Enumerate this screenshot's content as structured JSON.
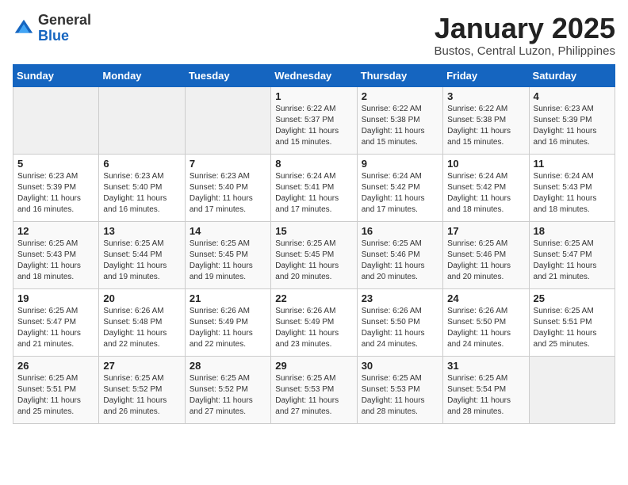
{
  "header": {
    "logo_general": "General",
    "logo_blue": "Blue",
    "month_title": "January 2025",
    "location": "Bustos, Central Luzon, Philippines"
  },
  "weekdays": [
    "Sunday",
    "Monday",
    "Tuesday",
    "Wednesday",
    "Thursday",
    "Friday",
    "Saturday"
  ],
  "weeks": [
    [
      {
        "day": "",
        "info": ""
      },
      {
        "day": "",
        "info": ""
      },
      {
        "day": "",
        "info": ""
      },
      {
        "day": "1",
        "info": "Sunrise: 6:22 AM\nSunset: 5:37 PM\nDaylight: 11 hours\nand 15 minutes."
      },
      {
        "day": "2",
        "info": "Sunrise: 6:22 AM\nSunset: 5:38 PM\nDaylight: 11 hours\nand 15 minutes."
      },
      {
        "day": "3",
        "info": "Sunrise: 6:22 AM\nSunset: 5:38 PM\nDaylight: 11 hours\nand 15 minutes."
      },
      {
        "day": "4",
        "info": "Sunrise: 6:23 AM\nSunset: 5:39 PM\nDaylight: 11 hours\nand 16 minutes."
      }
    ],
    [
      {
        "day": "5",
        "info": "Sunrise: 6:23 AM\nSunset: 5:39 PM\nDaylight: 11 hours\nand 16 minutes."
      },
      {
        "day": "6",
        "info": "Sunrise: 6:23 AM\nSunset: 5:40 PM\nDaylight: 11 hours\nand 16 minutes."
      },
      {
        "day": "7",
        "info": "Sunrise: 6:23 AM\nSunset: 5:40 PM\nDaylight: 11 hours\nand 17 minutes."
      },
      {
        "day": "8",
        "info": "Sunrise: 6:24 AM\nSunset: 5:41 PM\nDaylight: 11 hours\nand 17 minutes."
      },
      {
        "day": "9",
        "info": "Sunrise: 6:24 AM\nSunset: 5:42 PM\nDaylight: 11 hours\nand 17 minutes."
      },
      {
        "day": "10",
        "info": "Sunrise: 6:24 AM\nSunset: 5:42 PM\nDaylight: 11 hours\nand 18 minutes."
      },
      {
        "day": "11",
        "info": "Sunrise: 6:24 AM\nSunset: 5:43 PM\nDaylight: 11 hours\nand 18 minutes."
      }
    ],
    [
      {
        "day": "12",
        "info": "Sunrise: 6:25 AM\nSunset: 5:43 PM\nDaylight: 11 hours\nand 18 minutes."
      },
      {
        "day": "13",
        "info": "Sunrise: 6:25 AM\nSunset: 5:44 PM\nDaylight: 11 hours\nand 19 minutes."
      },
      {
        "day": "14",
        "info": "Sunrise: 6:25 AM\nSunset: 5:45 PM\nDaylight: 11 hours\nand 19 minutes."
      },
      {
        "day": "15",
        "info": "Sunrise: 6:25 AM\nSunset: 5:45 PM\nDaylight: 11 hours\nand 20 minutes."
      },
      {
        "day": "16",
        "info": "Sunrise: 6:25 AM\nSunset: 5:46 PM\nDaylight: 11 hours\nand 20 minutes."
      },
      {
        "day": "17",
        "info": "Sunrise: 6:25 AM\nSunset: 5:46 PM\nDaylight: 11 hours\nand 20 minutes."
      },
      {
        "day": "18",
        "info": "Sunrise: 6:25 AM\nSunset: 5:47 PM\nDaylight: 11 hours\nand 21 minutes."
      }
    ],
    [
      {
        "day": "19",
        "info": "Sunrise: 6:25 AM\nSunset: 5:47 PM\nDaylight: 11 hours\nand 21 minutes."
      },
      {
        "day": "20",
        "info": "Sunrise: 6:26 AM\nSunset: 5:48 PM\nDaylight: 11 hours\nand 22 minutes."
      },
      {
        "day": "21",
        "info": "Sunrise: 6:26 AM\nSunset: 5:49 PM\nDaylight: 11 hours\nand 22 minutes."
      },
      {
        "day": "22",
        "info": "Sunrise: 6:26 AM\nSunset: 5:49 PM\nDaylight: 11 hours\nand 23 minutes."
      },
      {
        "day": "23",
        "info": "Sunrise: 6:26 AM\nSunset: 5:50 PM\nDaylight: 11 hours\nand 24 minutes."
      },
      {
        "day": "24",
        "info": "Sunrise: 6:26 AM\nSunset: 5:50 PM\nDaylight: 11 hours\nand 24 minutes."
      },
      {
        "day": "25",
        "info": "Sunrise: 6:25 AM\nSunset: 5:51 PM\nDaylight: 11 hours\nand 25 minutes."
      }
    ],
    [
      {
        "day": "26",
        "info": "Sunrise: 6:25 AM\nSunset: 5:51 PM\nDaylight: 11 hours\nand 25 minutes."
      },
      {
        "day": "27",
        "info": "Sunrise: 6:25 AM\nSunset: 5:52 PM\nDaylight: 11 hours\nand 26 minutes."
      },
      {
        "day": "28",
        "info": "Sunrise: 6:25 AM\nSunset: 5:52 PM\nDaylight: 11 hours\nand 27 minutes."
      },
      {
        "day": "29",
        "info": "Sunrise: 6:25 AM\nSunset: 5:53 PM\nDaylight: 11 hours\nand 27 minutes."
      },
      {
        "day": "30",
        "info": "Sunrise: 6:25 AM\nSunset: 5:53 PM\nDaylight: 11 hours\nand 28 minutes."
      },
      {
        "day": "31",
        "info": "Sunrise: 6:25 AM\nSunset: 5:54 PM\nDaylight: 11 hours\nand 28 minutes."
      },
      {
        "day": "",
        "info": ""
      }
    ]
  ]
}
